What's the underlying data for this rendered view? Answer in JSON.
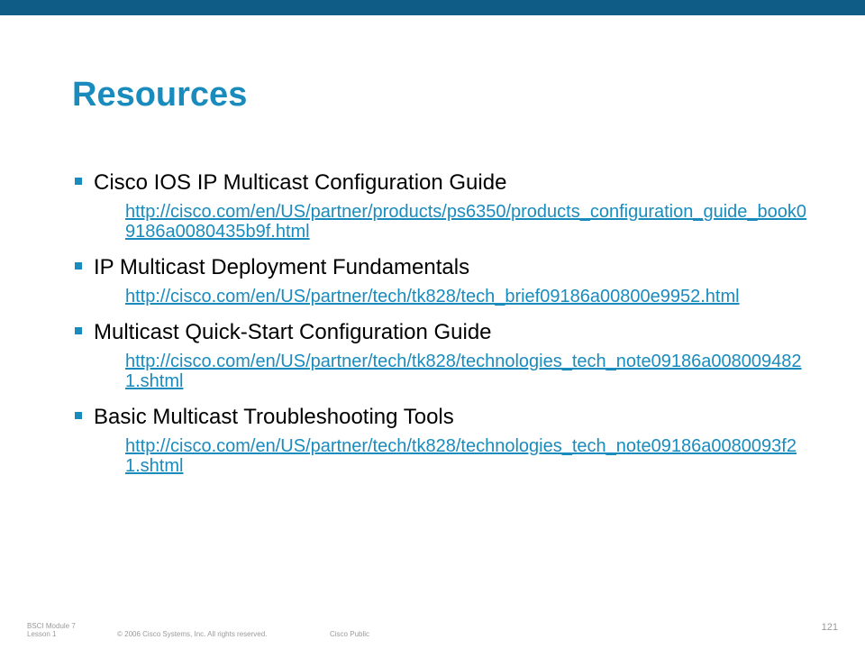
{
  "slide": {
    "title": "Resources"
  },
  "items": [
    {
      "heading": "Cisco IOS IP Multicast Configuration Guide",
      "link": "http://cisco.com/en/US/partner/products/ps6350/products_configuration_guide_book09186a0080435b9f.html"
    },
    {
      "heading": "IP Multicast Deployment Fundamentals",
      "link": "http://cisco.com/en/US/partner/tech/tk828/tech_brief09186a00800e9952.html"
    },
    {
      "heading": "Multicast Quick-Start Configuration Guide",
      "link": "http://cisco.com/en/US/partner/tech/tk828/technologies_tech_note09186a0080094821.shtml"
    },
    {
      "heading": "Basic Multicast Troubleshooting Tools",
      "link": "http://cisco.com/en/US/partner/tech/tk828/technologies_tech_note09186a0080093f21.shtml"
    }
  ],
  "footer": {
    "course": "BSCI Module 7",
    "lesson": "Lesson 1",
    "copyright": "© 2006 Cisco Systems, Inc. All rights reserved.",
    "classification": "Cisco Public",
    "page_number": "121"
  },
  "colors": {
    "top_bar": "#0f5d87",
    "accent": "#1a8bbd"
  }
}
